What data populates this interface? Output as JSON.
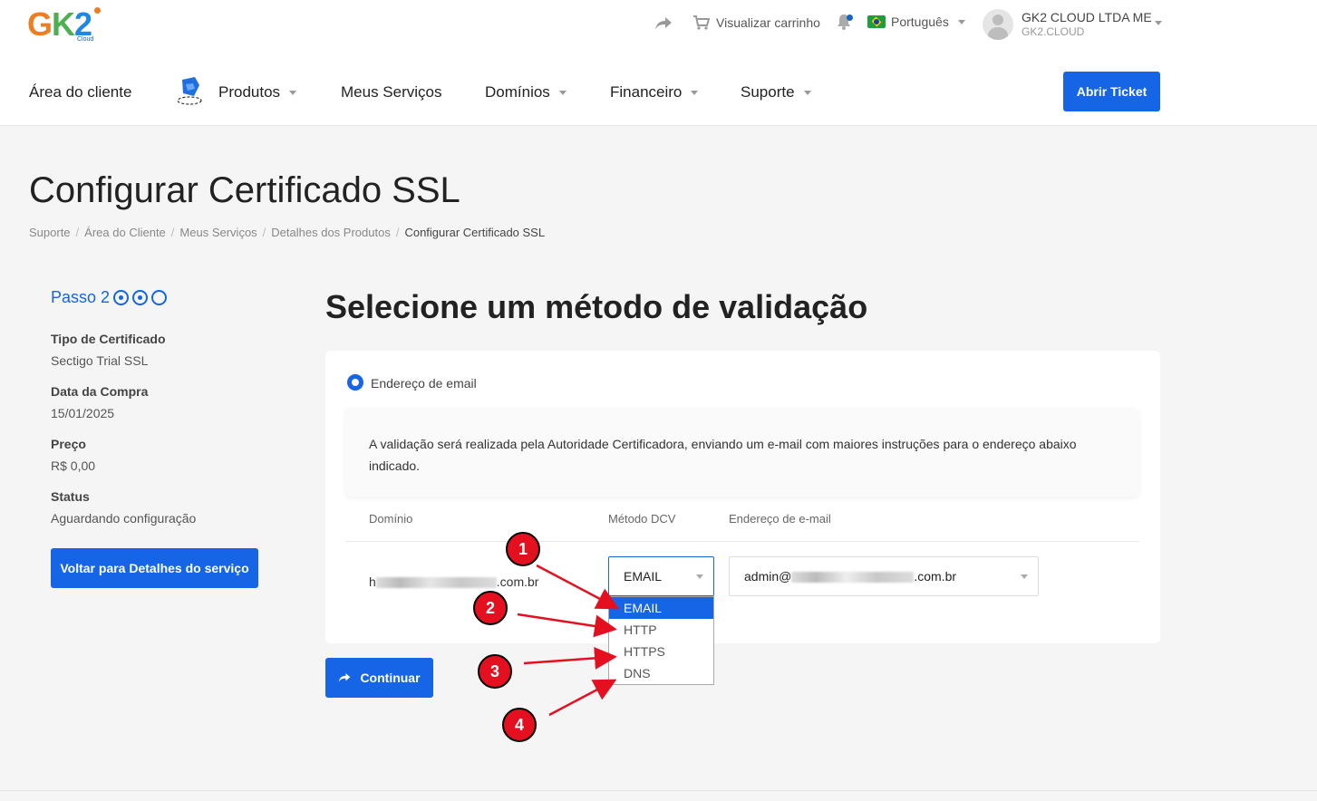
{
  "brand": {
    "logo_text_g": "G",
    "logo_text_k": "K",
    "logo_text_2": "2",
    "logo_sub": "Cloud"
  },
  "topbar": {
    "cart_label": "Visualizar carrinho",
    "language": "Português",
    "user_name": "GK2 CLOUD LTDA ME",
    "user_domain": "GK2.CLOUD"
  },
  "nav": {
    "items": [
      {
        "label": "Área do cliente"
      },
      {
        "label": "Produtos"
      },
      {
        "label": "Meus Serviços"
      },
      {
        "label": "Domínios"
      },
      {
        "label": "Financeiro"
      },
      {
        "label": "Suporte"
      }
    ],
    "ticket_button": "Abrir Ticket"
  },
  "page": {
    "title": "Configurar Certificado SSL",
    "breadcrumb": [
      "Suporte",
      "Área do Cliente",
      "Meus Serviços",
      "Detalhes dos Produtos",
      "Configurar Certificado SSL"
    ]
  },
  "sidebar": {
    "step_label": "Passo 2",
    "fields": [
      {
        "label": "Tipo de Certificado",
        "value": "Sectigo Trial SSL"
      },
      {
        "label": "Data da Compra",
        "value": "15/01/2025"
      },
      {
        "label": "Preço",
        "value": "R$ 0,00"
      },
      {
        "label": "Status",
        "value": "Aguardando configuração"
      }
    ],
    "back_button": "Voltar para Detalhes do serviço"
  },
  "main": {
    "title": "Selecione um método de validação",
    "radio_label": "Endereço de email",
    "info_text": "A validação será realizada pela Autoridade Certificadora, enviando um e-mail com maiores instruções para o endereço abaixo indicado.",
    "columns": [
      "Domínio",
      "Método DCV",
      "Endereço de e-mail"
    ],
    "domain_prefix": "h",
    "domain_suffix": ".com.br",
    "dcv_selected": "EMAIL",
    "dcv_options": [
      "EMAIL",
      "HTTP",
      "HTTPS",
      "DNS"
    ],
    "email_prefix": "admin@",
    "email_suffix": ".com.br",
    "continue_button": "Continuar"
  },
  "annotations": {
    "markers": [
      "1",
      "2",
      "3",
      "4"
    ],
    "marker_color": "#e4101f",
    "arrow_color": "#e4101f"
  },
  "colors": {
    "primary": "#1565e6",
    "background": "#f5f5f5"
  }
}
